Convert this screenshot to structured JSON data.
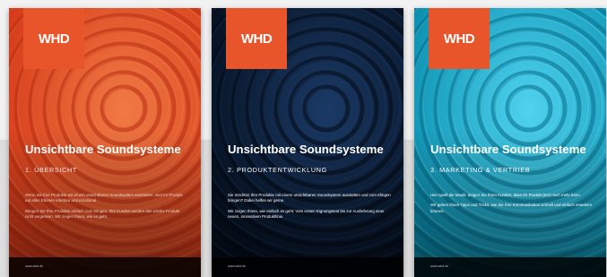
{
  "posters": [
    {
      "logo": "WHD",
      "title": "Unsichtbare Soundsysteme",
      "subtitle": "1. ÜBERSICHT",
      "body": [
        "Wenn Sie Ihre Produkte mit einem unsichtbaren Soundsystem ausstatten, wird Ihr Produkt auf allen Ebenen erlebbar und emotional.",
        "Bringen Sie Ihre Produkte einfach zum Klingen. Ihre Kunden werden das erlebte Produkt nicht vergessen. Wir zeigen Ihnen, wie es geht."
      ],
      "footer": "www.whd.de",
      "colors": {
        "base": "#d63a19",
        "ring_light": "#f07a45",
        "ring_dark": "#b82c10"
      }
    },
    {
      "logo": "WHD",
      "title": "Unsichtbare Soundsysteme",
      "subtitle": "2. PRODUKTENTWICKLUNG",
      "body": [
        "Sie möchten Ihre Produkte mit einem unsichtbaren Soundsystem ausstatten und zum Klingen bringen? Dabei helfen wir gerne.",
        "Wir zeigen Ihnen, wie einfach es geht: Vom ersten Eignungstest bis zur Auslieferung einer neuen, innovativen Produktlinie."
      ],
      "footer": "www.whd.de",
      "colors": {
        "base": "#05101f",
        "ring_light": "#1b3a66",
        "ring_dark": "#030a14"
      }
    },
    {
      "logo": "WHD",
      "title": "Unsichtbare Soundsysteme",
      "subtitle": "3. MARKETING & VERTRIEB",
      "body": [
        "Hier spielt die Musik: Zeigen Sie Ihren Kunden, dass Ihr Produkt jetzt noch mehr kann.",
        "Wir geben Ihnen Tipps und Tricks, wie Sie Ihre Kommunikation schnell und einfach erweitern können."
      ],
      "footer": "www.whd.de",
      "colors": {
        "base": "#0a8fb0",
        "ring_light": "#4fd3ef",
        "ring_dark": "#066b88"
      }
    }
  ]
}
